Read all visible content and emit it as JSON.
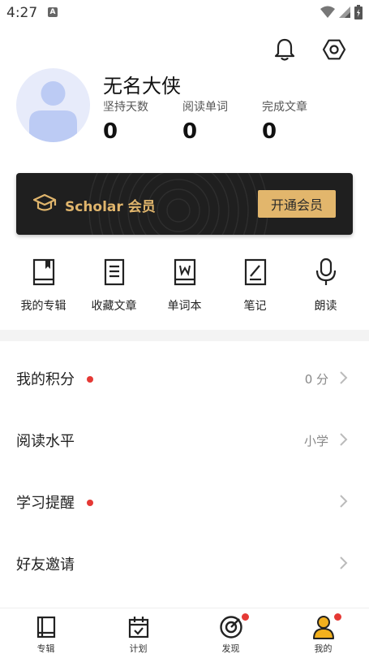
{
  "status_bar": {
    "time": "4:27",
    "notification_badge": "A",
    "icons": [
      "wifi-icon",
      "signal-icon",
      "battery-icon"
    ]
  },
  "header": {
    "icons": [
      "bell-icon",
      "settings-icon"
    ]
  },
  "profile": {
    "name": "无名大侠",
    "stats": [
      {
        "label": "坚持天数",
        "value": "0"
      },
      {
        "label": "阅读单词",
        "value": "0"
      },
      {
        "label": "完成文章",
        "value": "0"
      }
    ]
  },
  "vip": {
    "title": "Scholar 会员",
    "button_label": "开通会员",
    "accent_color": "#e2b66c",
    "background_color": "#1f1f1f"
  },
  "shortcuts": [
    {
      "label": "我的专辑",
      "icon": "album-icon"
    },
    {
      "label": "收藏文章",
      "icon": "article-icon"
    },
    {
      "label": "单词本",
      "icon": "wordbook-icon"
    },
    {
      "label": "笔记",
      "icon": "note-icon"
    },
    {
      "label": "朗读",
      "icon": "microphone-icon"
    }
  ],
  "menu": [
    {
      "label": "我的积分",
      "value": "0 分",
      "dot": true
    },
    {
      "label": "阅读水平",
      "value": "小学",
      "dot": false
    },
    {
      "label": "学习提醒",
      "value": "",
      "dot": true
    },
    {
      "label": "好友邀请",
      "value": "",
      "dot": false
    }
  ],
  "tabbar": {
    "items": [
      {
        "label": "专辑",
        "icon": "book-icon",
        "dot": false
      },
      {
        "label": "计划",
        "icon": "calendar-icon",
        "dot": false
      },
      {
        "label": "发现",
        "icon": "target-icon",
        "dot": true
      },
      {
        "label": "我的",
        "icon": "user-icon",
        "dot": true,
        "active": true
      }
    ]
  },
  "colors": {
    "notification_dot": "#e53935",
    "active_tab": "#f2b01e"
  }
}
